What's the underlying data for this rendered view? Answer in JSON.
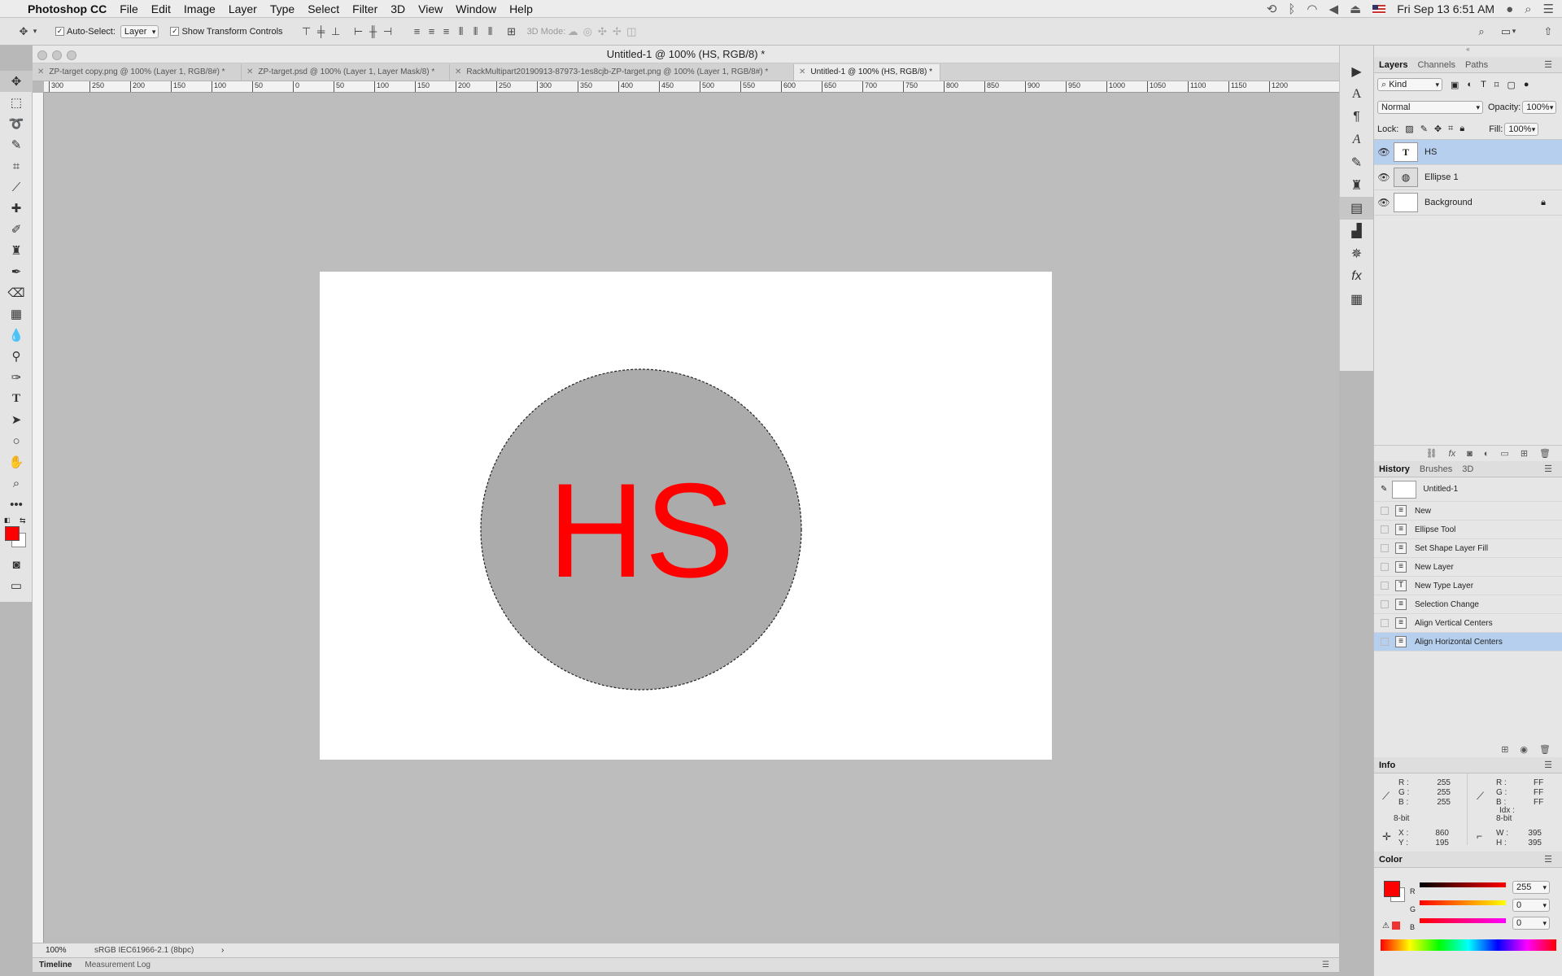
{
  "menubar": {
    "app": "Photoshop CC",
    "items": [
      "File",
      "Edit",
      "Image",
      "Layer",
      "Type",
      "Select",
      "Filter",
      "3D",
      "View",
      "Window",
      "Help"
    ],
    "clock": "Fri Sep 13  6:51 AM"
  },
  "options": {
    "auto_select_label": "Auto-Select:",
    "auto_select_value": "Layer",
    "show_transform_label": "Show Transform Controls",
    "mode_label": "3D Mode:"
  },
  "document": {
    "title": "Untitled-1 @ 100% (HS, RGB/8) *",
    "tabs": [
      "ZP-target copy.png @ 100% (Layer 1, RGB/8#) *",
      "ZP-target.psd @ 100% (Layer 1, Layer Mask/8) *",
      "RackMultipart20190913-87973-1es8cjb-ZP-target.png @ 100% (Layer 1, RGB/8#) *",
      "Untitled-1 @ 100% (HS, RGB/8) *"
    ],
    "active_tab_index": 3,
    "canvas_text": "HS",
    "text_color": "#ff0000",
    "ellipse_color": "#ababab",
    "ruler_labels": [
      "300",
      "250",
      "200",
      "150",
      "100",
      "50",
      "0",
      "50",
      "100",
      "150",
      "200",
      "250",
      "300",
      "350",
      "400",
      "450",
      "500",
      "550",
      "600",
      "650",
      "700",
      "750",
      "800",
      "850",
      "900",
      "950",
      "1000",
      "1050",
      "1100",
      "1150",
      "1200"
    ],
    "status_zoom": "100%",
    "status_profile": "sRGB IEC61966-2.1 (8bpc)"
  },
  "bottom_tabs": [
    "Timeline",
    "Measurement Log"
  ],
  "layers_panel": {
    "tabs": [
      "Layers",
      "Channels",
      "Paths"
    ],
    "kind": "Kind",
    "blend_mode": "Normal",
    "opacity_label": "Opacity:",
    "opacity": "100%",
    "lock_label": "Lock:",
    "fill_label": "Fill:",
    "fill": "100%",
    "layers": [
      {
        "name": "HS",
        "type": "T",
        "selected": true
      },
      {
        "name": "Ellipse 1",
        "type": "shape",
        "selected": false
      },
      {
        "name": "Background",
        "type": "bg",
        "selected": false
      }
    ]
  },
  "history_panel": {
    "tabs": [
      "History",
      "Brushes",
      "3D"
    ],
    "snapshot": "Untitled-1",
    "items": [
      "New",
      "Ellipse Tool",
      "Set Shape Layer Fill",
      "New Layer",
      "New Type Layer",
      "Selection Change",
      "Align Vertical Centers",
      "Align Horizontal Centers"
    ],
    "selected_index": 7
  },
  "info_panel": {
    "title": "Info",
    "r": "255",
    "g": "255",
    "b": "255",
    "r_hex": "FF",
    "g_hex": "FF",
    "b_hex": "FF",
    "bit_left": "8-bit",
    "bit_right": "8-bit",
    "idx_label": "Idx :",
    "x": "860",
    "y": "195",
    "w": "395",
    "h": "395"
  },
  "color_panel": {
    "title": "Color",
    "r": "255",
    "g": "0",
    "b": "0",
    "foreground": "#ff0000"
  }
}
